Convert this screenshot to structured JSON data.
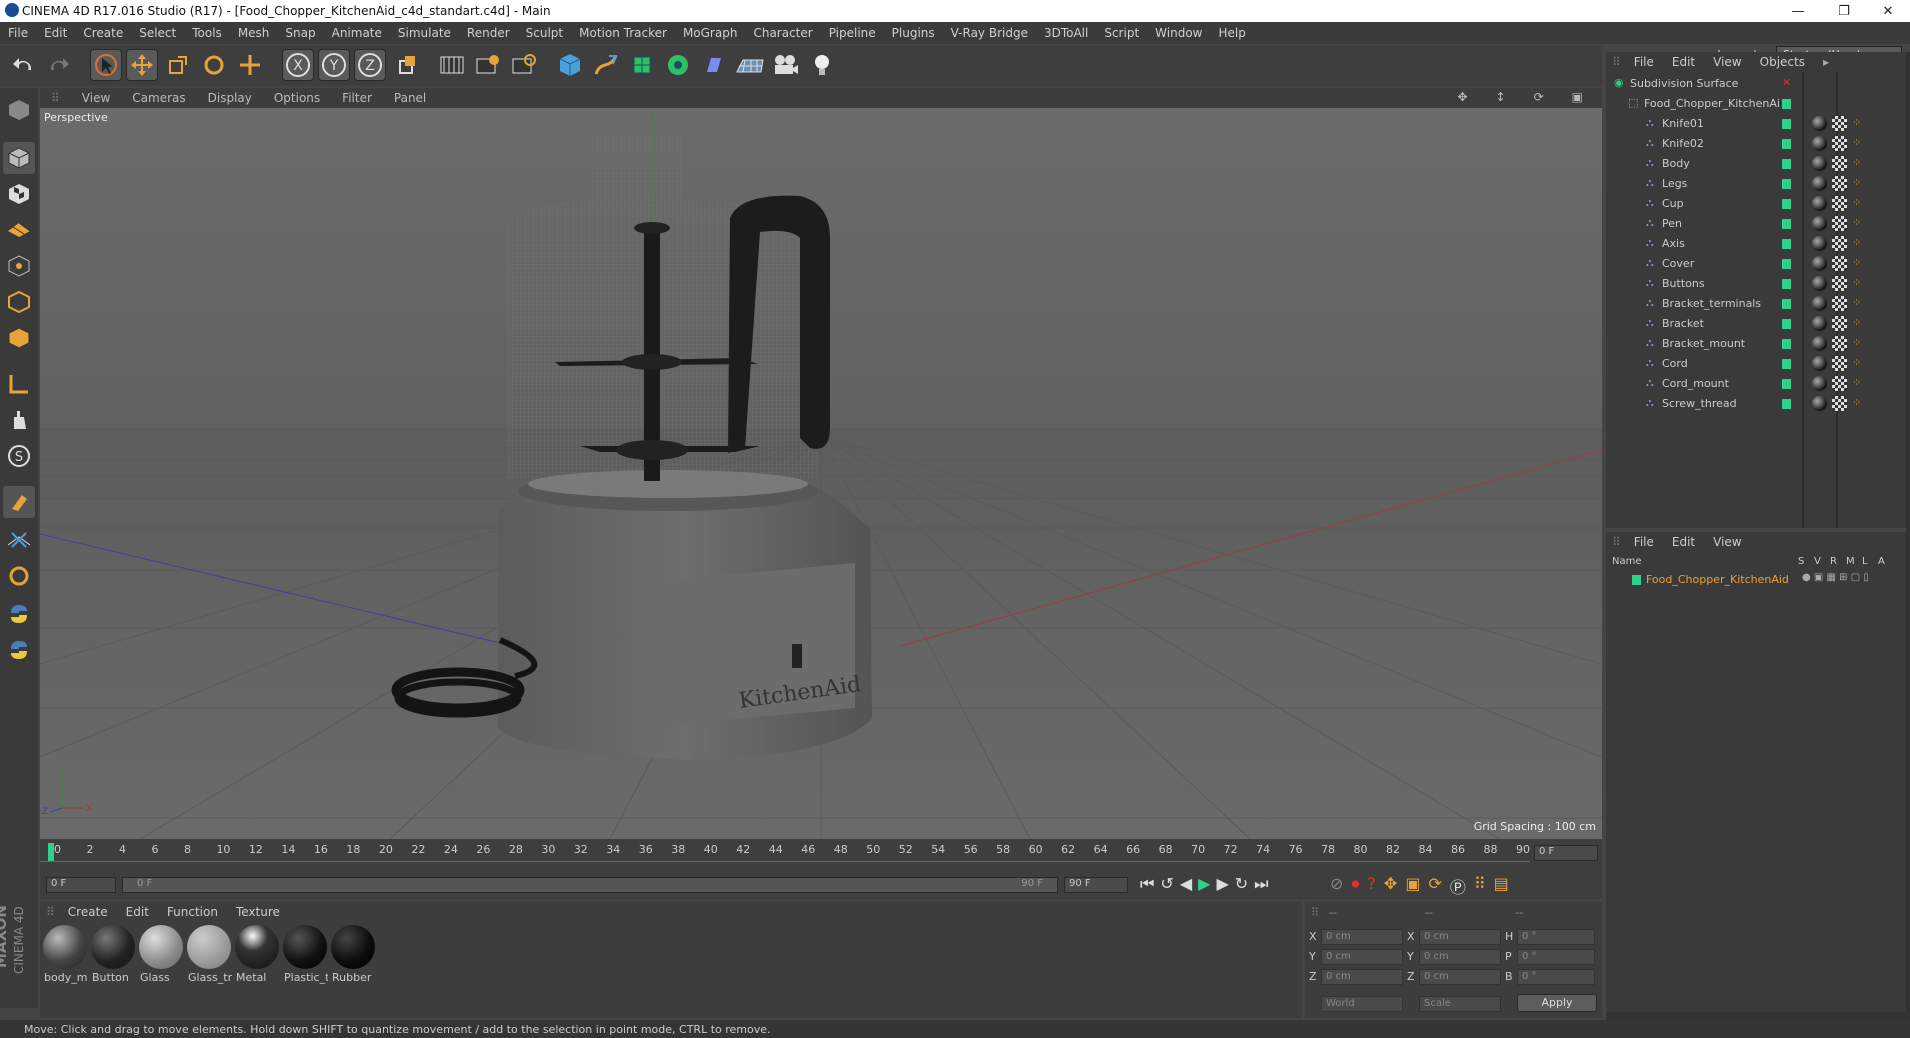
{
  "window": {
    "title": "CINEMA 4D R17.016 Studio (R17) - [Food_Chopper_KitchenAid_c4d_standart.c4d] - Main",
    "minimize": "—",
    "restore": "❐",
    "close": "✕"
  },
  "menubar": {
    "items": [
      "File",
      "Edit",
      "Create",
      "Select",
      "Tools",
      "Mesh",
      "Snap",
      "Animate",
      "Simulate",
      "Render",
      "Sculpt",
      "Motion Tracker",
      "MoGraph",
      "Character",
      "Pipeline",
      "Plugins",
      "V-Ray Bridge",
      "3DToAll",
      "Script",
      "Window",
      "Help"
    ],
    "layout_label": "Layout:",
    "layout_value": "Startup (User)"
  },
  "viewport": {
    "menu": [
      "View",
      "Cameras",
      "Display",
      "Options",
      "Filter",
      "Panel"
    ],
    "camera_label": "Perspective",
    "grid_spacing": "Grid Spacing : 100 cm",
    "logo_text": "KitchenAid"
  },
  "timeline": {
    "ticks": [
      "0",
      "2",
      "4",
      "6",
      "8",
      "10",
      "12",
      "14",
      "16",
      "18",
      "20",
      "22",
      "24",
      "26",
      "28",
      "30",
      "32",
      "34",
      "36",
      "38",
      "40",
      "42",
      "44",
      "46",
      "48",
      "50",
      "52",
      "54",
      "56",
      "58",
      "60",
      "62",
      "64",
      "66",
      "68",
      "70",
      "72",
      "74",
      "76",
      "78",
      "80",
      "82",
      "84",
      "86",
      "88",
      "90"
    ],
    "current_frame": "0 F",
    "start_field": "0 F",
    "range_start": "0 F",
    "range_end": "90 F",
    "end_field": "90 F"
  },
  "materials": {
    "menu": [
      "Create",
      "Edit",
      "Function",
      "Texture"
    ],
    "items": [
      {
        "name": "body_m"
      },
      {
        "name": "Button"
      },
      {
        "name": "Glass"
      },
      {
        "name": "Glass_tr"
      },
      {
        "name": "Metal"
      },
      {
        "name": "Plastic_t"
      },
      {
        "name": "Rubber"
      }
    ]
  },
  "coords": {
    "header": [
      "--",
      "--",
      "--"
    ],
    "rows": [
      {
        "a": "X",
        "av": "0 cm",
        "b": "X",
        "bv": "0 cm",
        "c": "H",
        "cv": "0 °"
      },
      {
        "a": "Y",
        "av": "0 cm",
        "b": "Y",
        "bv": "0 cm",
        "c": "P",
        "cv": "0 °"
      },
      {
        "a": "Z",
        "av": "0 cm",
        "b": "Z",
        "bv": "0 cm",
        "c": "B",
        "cv": "0 °"
      }
    ],
    "mode": "World",
    "scale": "Scale",
    "apply": "Apply"
  },
  "objects": {
    "menu": [
      "File",
      "Edit",
      "View",
      "Objects"
    ],
    "root": "Subdivision Surface",
    "group": "Food_Chopper_KitchenAi",
    "children": [
      "Knife01",
      "Knife02",
      "Body",
      "Legs",
      "Cup",
      "Pen",
      "Axis",
      "Cover",
      "Buttons",
      "Bracket_terminals",
      "Bracket",
      "Bracket_mount",
      "Cord",
      "Cord_mount",
      "Screw_thread"
    ]
  },
  "attributes": {
    "menu": [
      "File",
      "Edit",
      "View"
    ],
    "col_name": "Name",
    "cols": [
      "S",
      "V",
      "R",
      "M",
      "L",
      "A"
    ],
    "row": "Food_Chopper_KitchenAid"
  },
  "status": {
    "text": "Move: Click and drag to move elements. Hold down SHIFT to quantize movement / add to the selection in point mode, CTRL to remove."
  },
  "brand": {
    "maxon": "MAXON",
    "c4d": "CINEMA 4D"
  },
  "colors": {
    "accent_green": "#2fd08c",
    "object_orange": "#e8a23a",
    "viewport_bg": "#6d6d6d"
  }
}
